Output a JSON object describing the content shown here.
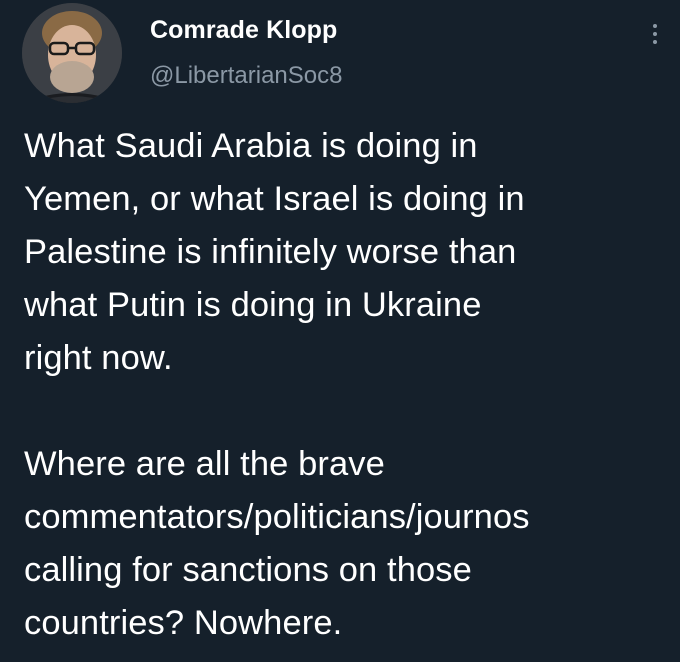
{
  "author": {
    "display_name": "Comrade Klopp",
    "handle": "@LibertarianSoc8",
    "avatar_icon": "profile-photo"
  },
  "menu": {
    "icon": "more-vertical-icon"
  },
  "tweet": {
    "paragraph1": {
      "lines": [
        "What Saudi Arabia is doing in",
        "Yemen, or what Israel is doing in",
        "Palestine is infinitely worse than",
        "what Putin is doing in Ukraine",
        "right now."
      ]
    },
    "paragraph2": {
      "lines": [
        "Where are all the brave",
        "commentators/politicians/journos",
        "calling for sanctions on those",
        "countries? Nowhere."
      ]
    }
  },
  "colors": {
    "background": "#15202b",
    "text_primary": "#ffffff",
    "text_secondary": "#8b98a5"
  }
}
